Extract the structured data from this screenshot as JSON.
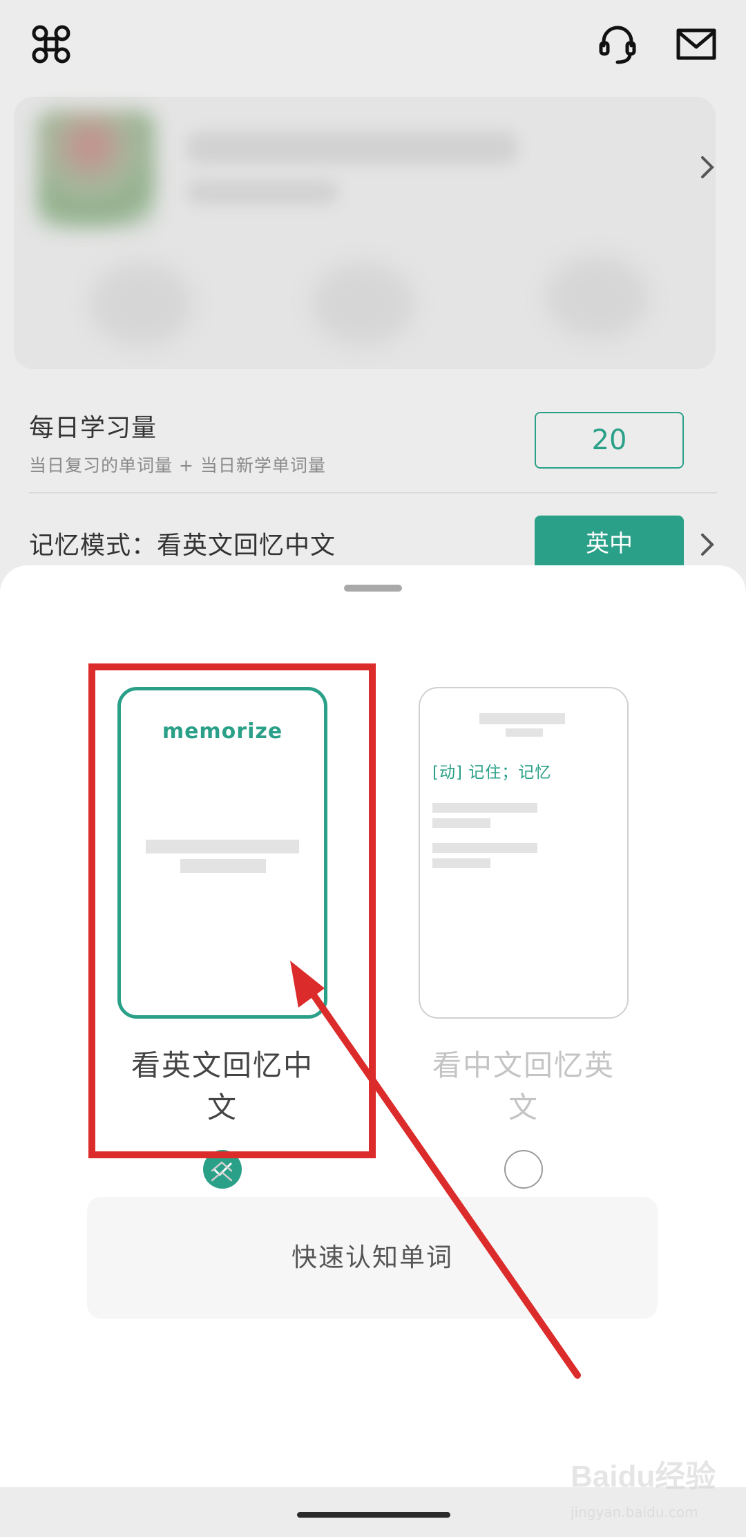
{
  "top_bar": {
    "icons": [
      "command-icon",
      "headset-icon",
      "mail-icon"
    ]
  },
  "settings": {
    "daily_title": "每日学习量",
    "daily_subtitle": "当日复习的单词量 + 当日新学单词量",
    "daily_count": "20",
    "mode_title": "记忆模式：看英文回忆中文",
    "mode_button": "英中"
  },
  "mode_sheet": {
    "option_en_to_cn": {
      "preview_word": "memorize",
      "label": "看英文回忆中文",
      "selected": true
    },
    "option_cn_to_en": {
      "preview_definition": "[动] 记住；记忆",
      "label": "看中文回忆英文",
      "selected": false
    },
    "description": "快速认知单词"
  },
  "watermark": {
    "brand": "Baidu经验",
    "sub": "jingyan.baidu.com"
  },
  "colors": {
    "accent": "#2aa088",
    "annotation": "#dc2b2b"
  }
}
